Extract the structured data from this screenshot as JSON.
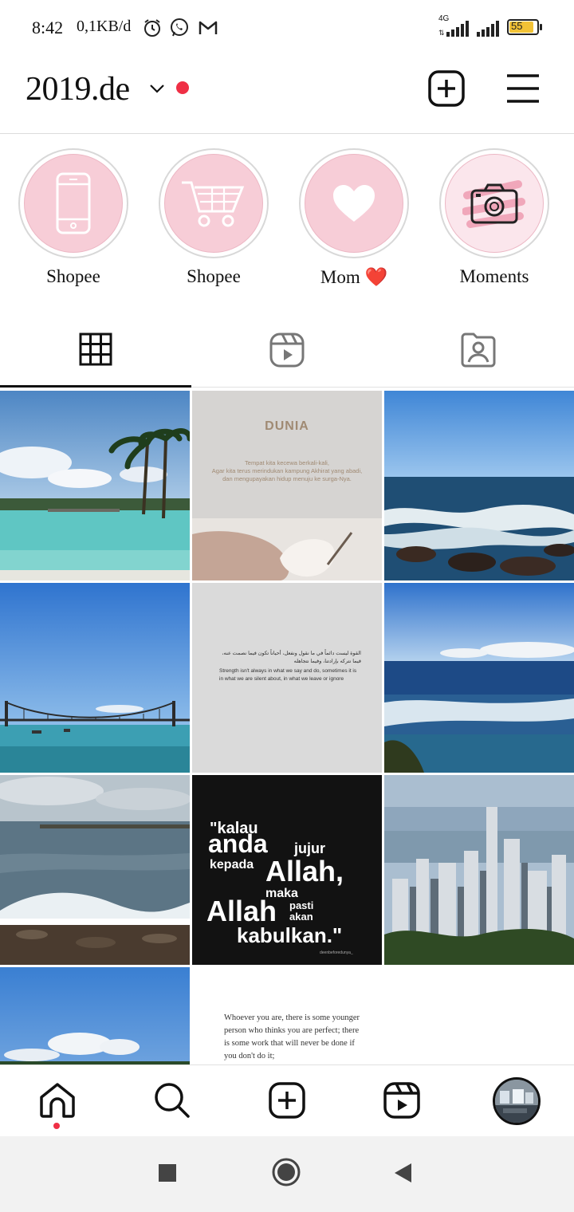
{
  "status_bar": {
    "time": "8:42",
    "speed": "0,1KB/d",
    "network": "4G",
    "battery": "55"
  },
  "header": {
    "username": "2019.de"
  },
  "highlights": [
    {
      "label": "Shopee",
      "icon": "phone-icon"
    },
    {
      "label": "Shopee",
      "icon": "cart-icon"
    },
    {
      "label": "Mom",
      "emoji": "❤️",
      "icon": "heart-icon"
    },
    {
      "label": "Moments",
      "icon": "camera-icon"
    }
  ],
  "tabs": [
    "grid-tab",
    "reels-tab",
    "tagged-tab"
  ],
  "posts": {
    "dunia": {
      "title": "DUNIA",
      "body": "Tempat kita kecewa berkali-kali,\nAgar kita terus merindukan kampung Akhirat yang abadi,\ndan mengupayakan hidup menuju ke surga-Nya."
    },
    "strength": {
      "arabic": "القوة ليست دائماً في ما نقول ونفعل، أحياناً تكون فيما نصمت عنه، فيما نتركه بإرادتنا، وفيما نتجاهله",
      "english": "Strength isn't always in what we say and do, sometimes it is in what we are silent about, in what we leave or ignore"
    },
    "kalau": {
      "l1a": "\"kalau",
      "l2a": "anda",
      "l2b": "jujur",
      "l3a": "kepada",
      "l3b": "Allah,",
      "l4": "maka",
      "l5a": "Allah",
      "l5b": "pasti",
      "l5c": "akan",
      "l6": "kabulkan.\"",
      "credit": "deenbeforedunya_"
    },
    "whoever": {
      "body": "Whoever you are, there is some younger person who thinks you are perfect; there is some work that will never be done if you don't do it;"
    }
  },
  "colors": {
    "accent_red": "#ef2f45",
    "highlight_pink": "#f7cdd7"
  }
}
